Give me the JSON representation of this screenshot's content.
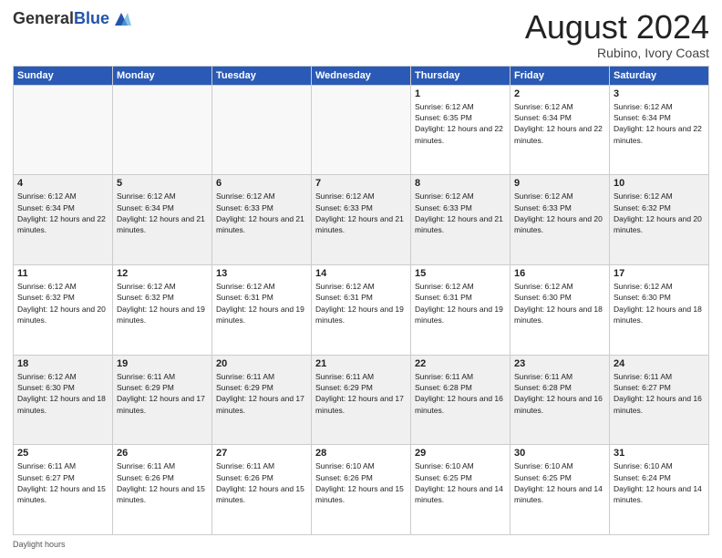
{
  "logo": {
    "general": "General",
    "blue": "Blue"
  },
  "title": "August 2024",
  "location": "Rubino, Ivory Coast",
  "weekdays": [
    "Sunday",
    "Monday",
    "Tuesday",
    "Wednesday",
    "Thursday",
    "Friday",
    "Saturday"
  ],
  "rows": [
    [
      {
        "day": "",
        "sunrise": "",
        "sunset": "",
        "daylight": ""
      },
      {
        "day": "",
        "sunrise": "",
        "sunset": "",
        "daylight": ""
      },
      {
        "day": "",
        "sunrise": "",
        "sunset": "",
        "daylight": ""
      },
      {
        "day": "",
        "sunrise": "",
        "sunset": "",
        "daylight": ""
      },
      {
        "day": "1",
        "sunrise": "Sunrise: 6:12 AM",
        "sunset": "Sunset: 6:35 PM",
        "daylight": "Daylight: 12 hours and 22 minutes."
      },
      {
        "day": "2",
        "sunrise": "Sunrise: 6:12 AM",
        "sunset": "Sunset: 6:34 PM",
        "daylight": "Daylight: 12 hours and 22 minutes."
      },
      {
        "day": "3",
        "sunrise": "Sunrise: 6:12 AM",
        "sunset": "Sunset: 6:34 PM",
        "daylight": "Daylight: 12 hours and 22 minutes."
      }
    ],
    [
      {
        "day": "4",
        "sunrise": "Sunrise: 6:12 AM",
        "sunset": "Sunset: 6:34 PM",
        "daylight": "Daylight: 12 hours and 22 minutes."
      },
      {
        "day": "5",
        "sunrise": "Sunrise: 6:12 AM",
        "sunset": "Sunset: 6:34 PM",
        "daylight": "Daylight: 12 hours and 21 minutes."
      },
      {
        "day": "6",
        "sunrise": "Sunrise: 6:12 AM",
        "sunset": "Sunset: 6:33 PM",
        "daylight": "Daylight: 12 hours and 21 minutes."
      },
      {
        "day": "7",
        "sunrise": "Sunrise: 6:12 AM",
        "sunset": "Sunset: 6:33 PM",
        "daylight": "Daylight: 12 hours and 21 minutes."
      },
      {
        "day": "8",
        "sunrise": "Sunrise: 6:12 AM",
        "sunset": "Sunset: 6:33 PM",
        "daylight": "Daylight: 12 hours and 21 minutes."
      },
      {
        "day": "9",
        "sunrise": "Sunrise: 6:12 AM",
        "sunset": "Sunset: 6:33 PM",
        "daylight": "Daylight: 12 hours and 20 minutes."
      },
      {
        "day": "10",
        "sunrise": "Sunrise: 6:12 AM",
        "sunset": "Sunset: 6:32 PM",
        "daylight": "Daylight: 12 hours and 20 minutes."
      }
    ],
    [
      {
        "day": "11",
        "sunrise": "Sunrise: 6:12 AM",
        "sunset": "Sunset: 6:32 PM",
        "daylight": "Daylight: 12 hours and 20 minutes."
      },
      {
        "day": "12",
        "sunrise": "Sunrise: 6:12 AM",
        "sunset": "Sunset: 6:32 PM",
        "daylight": "Daylight: 12 hours and 19 minutes."
      },
      {
        "day": "13",
        "sunrise": "Sunrise: 6:12 AM",
        "sunset": "Sunset: 6:31 PM",
        "daylight": "Daylight: 12 hours and 19 minutes."
      },
      {
        "day": "14",
        "sunrise": "Sunrise: 6:12 AM",
        "sunset": "Sunset: 6:31 PM",
        "daylight": "Daylight: 12 hours and 19 minutes."
      },
      {
        "day": "15",
        "sunrise": "Sunrise: 6:12 AM",
        "sunset": "Sunset: 6:31 PM",
        "daylight": "Daylight: 12 hours and 19 minutes."
      },
      {
        "day": "16",
        "sunrise": "Sunrise: 6:12 AM",
        "sunset": "Sunset: 6:30 PM",
        "daylight": "Daylight: 12 hours and 18 minutes."
      },
      {
        "day": "17",
        "sunrise": "Sunrise: 6:12 AM",
        "sunset": "Sunset: 6:30 PM",
        "daylight": "Daylight: 12 hours and 18 minutes."
      }
    ],
    [
      {
        "day": "18",
        "sunrise": "Sunrise: 6:12 AM",
        "sunset": "Sunset: 6:30 PM",
        "daylight": "Daylight: 12 hours and 18 minutes."
      },
      {
        "day": "19",
        "sunrise": "Sunrise: 6:11 AM",
        "sunset": "Sunset: 6:29 PM",
        "daylight": "Daylight: 12 hours and 17 minutes."
      },
      {
        "day": "20",
        "sunrise": "Sunrise: 6:11 AM",
        "sunset": "Sunset: 6:29 PM",
        "daylight": "Daylight: 12 hours and 17 minutes."
      },
      {
        "day": "21",
        "sunrise": "Sunrise: 6:11 AM",
        "sunset": "Sunset: 6:29 PM",
        "daylight": "Daylight: 12 hours and 17 minutes."
      },
      {
        "day": "22",
        "sunrise": "Sunrise: 6:11 AM",
        "sunset": "Sunset: 6:28 PM",
        "daylight": "Daylight: 12 hours and 16 minutes."
      },
      {
        "day": "23",
        "sunrise": "Sunrise: 6:11 AM",
        "sunset": "Sunset: 6:28 PM",
        "daylight": "Daylight: 12 hours and 16 minutes."
      },
      {
        "day": "24",
        "sunrise": "Sunrise: 6:11 AM",
        "sunset": "Sunset: 6:27 PM",
        "daylight": "Daylight: 12 hours and 16 minutes."
      }
    ],
    [
      {
        "day": "25",
        "sunrise": "Sunrise: 6:11 AM",
        "sunset": "Sunset: 6:27 PM",
        "daylight": "Daylight: 12 hours and 15 minutes."
      },
      {
        "day": "26",
        "sunrise": "Sunrise: 6:11 AM",
        "sunset": "Sunset: 6:26 PM",
        "daylight": "Daylight: 12 hours and 15 minutes."
      },
      {
        "day": "27",
        "sunrise": "Sunrise: 6:11 AM",
        "sunset": "Sunset: 6:26 PM",
        "daylight": "Daylight: 12 hours and 15 minutes."
      },
      {
        "day": "28",
        "sunrise": "Sunrise: 6:10 AM",
        "sunset": "Sunset: 6:26 PM",
        "daylight": "Daylight: 12 hours and 15 minutes."
      },
      {
        "day": "29",
        "sunrise": "Sunrise: 6:10 AM",
        "sunset": "Sunset: 6:25 PM",
        "daylight": "Daylight: 12 hours and 14 minutes."
      },
      {
        "day": "30",
        "sunrise": "Sunrise: 6:10 AM",
        "sunset": "Sunset: 6:25 PM",
        "daylight": "Daylight: 12 hours and 14 minutes."
      },
      {
        "day": "31",
        "sunrise": "Sunrise: 6:10 AM",
        "sunset": "Sunset: 6:24 PM",
        "daylight": "Daylight: 12 hours and 14 minutes."
      }
    ]
  ],
  "footer": {
    "daylight_label": "Daylight hours"
  }
}
